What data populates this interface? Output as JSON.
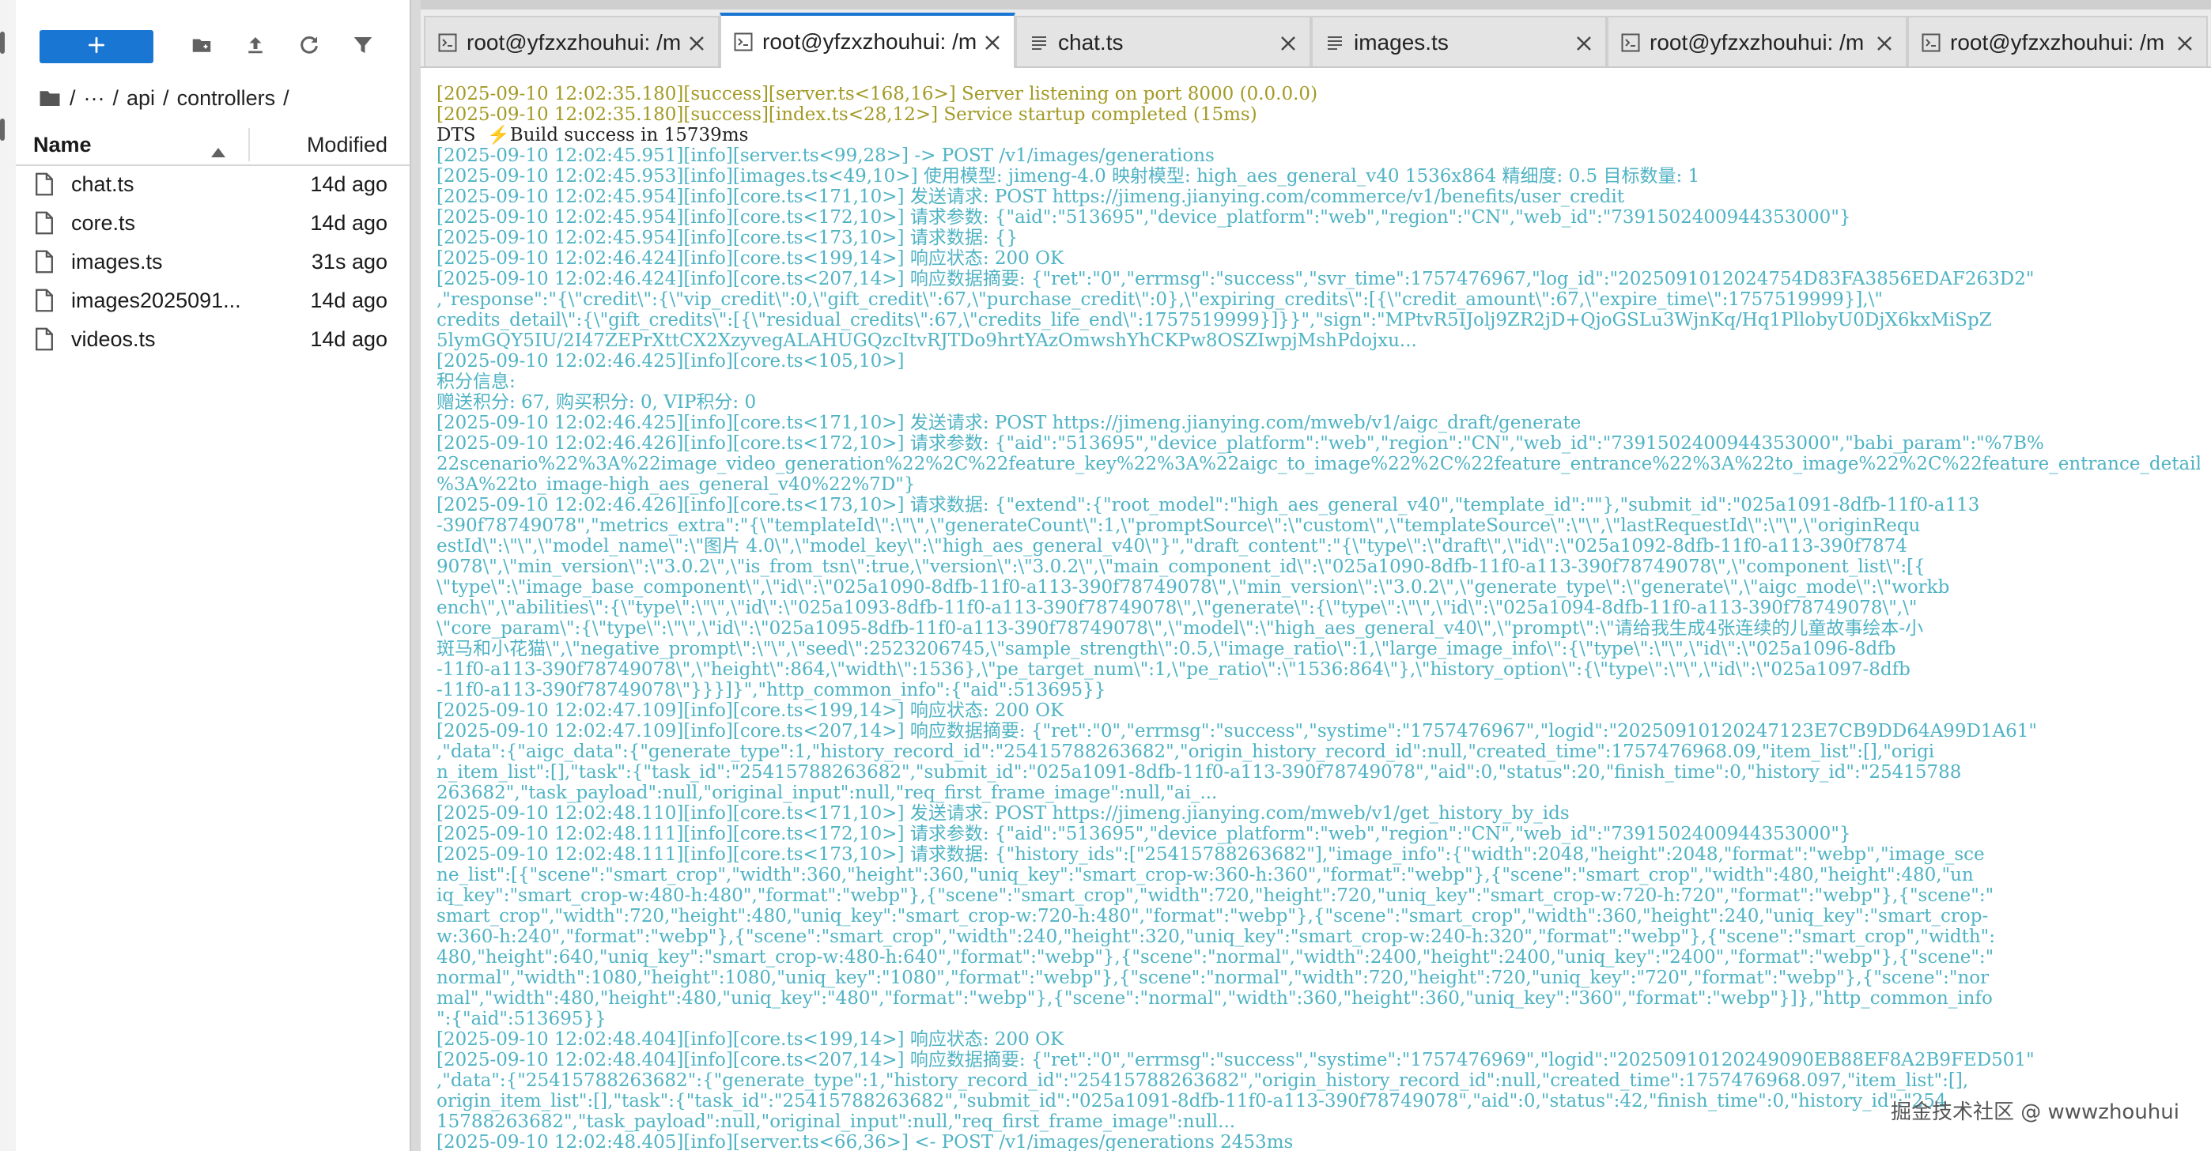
{
  "colors": {
    "accent": "#1976d2",
    "success_log": "#a39a25",
    "info_log": "#4fb3c4"
  },
  "file_browser": {
    "toolbar": {
      "new_icon": "plus-icon",
      "icons": [
        "new-folder-icon",
        "upload-icon",
        "refresh-icon",
        "filter-icon"
      ]
    },
    "breadcrumb": [
      "/",
      "···",
      "/",
      "api",
      "/",
      "controllers",
      "/"
    ],
    "columns": {
      "name": "Name",
      "modified": "Modified"
    },
    "files": [
      {
        "name": "chat.ts",
        "modified": "14d ago"
      },
      {
        "name": "core.ts",
        "modified": "14d ago"
      },
      {
        "name": "images.ts",
        "modified": "31s ago"
      },
      {
        "name": "images2025091...",
        "modified": "14d ago"
      },
      {
        "name": "videos.ts",
        "modified": "14d ago"
      }
    ]
  },
  "tabs": [
    {
      "label": "root@yfzxzhouhui: /m",
      "icon": "terminal-icon",
      "active": false
    },
    {
      "label": "root@yfzxzhouhui: /m",
      "icon": "terminal-icon",
      "active": true
    },
    {
      "label": "chat.ts",
      "icon": "text-file-icon",
      "active": false
    },
    {
      "label": "images.ts",
      "icon": "text-file-icon",
      "active": false
    },
    {
      "label": "root@yfzxzhouhui: /m",
      "icon": "terminal-icon",
      "active": false
    },
    {
      "label": "root@yfzxzhouhui: /m",
      "icon": "terminal-icon",
      "active": false
    }
  ],
  "terminal": {
    "lines": [
      {
        "kind": "ok",
        "text": "[2025-09-10 12:02:35.180][success][server.ts<168,16>] Server listening on port 8000 (0.0.0.0)"
      },
      {
        "kind": "ok",
        "text": "[2025-09-10 12:02:35.180][success][index.ts<28,12>] Service startup completed (15ms)"
      },
      {
        "kind": "plain",
        "text": "DTS  ⚡Build success in 15739ms"
      },
      {
        "kind": "info",
        "text": "[2025-09-10 12:02:45.951][info][server.ts<99,28>] -> POST /v1/images/generations"
      },
      {
        "kind": "info",
        "text": "[2025-09-10 12:02:45.953][info][images.ts<49,10>] 使用模型: jimeng-4.0 映射模型: high_aes_general_v40 1536x864 精细度: 0.5 目标数量: 1"
      },
      {
        "kind": "info",
        "text": "[2025-09-10 12:02:45.954][info][core.ts<171,10>] 发送请求: POST https://jimeng.jianying.com/commerce/v1/benefits/user_credit"
      },
      {
        "kind": "info",
        "text": "[2025-09-10 12:02:45.954][info][core.ts<172,10>] 请求参数: {\"aid\":\"513695\",\"device_platform\":\"web\",\"region\":\"CN\",\"web_id\":\"7391502400944353000\"}"
      },
      {
        "kind": "info",
        "text": "[2025-09-10 12:02:45.954][info][core.ts<173,10>] 请求数据: {}"
      },
      {
        "kind": "info",
        "text": "[2025-09-10 12:02:46.424][info][core.ts<199,14>] 响应状态: 200 OK"
      },
      {
        "kind": "info",
        "text": "[2025-09-10 12:02:46.424][info][core.ts<207,14>] 响应数据摘要: {\"ret\":\"0\",\"errmsg\":\"success\",\"svr_time\":1757476967,\"log_id\":\"2025091012024754D83FA3856EDAF263D2\""
      },
      {
        "kind": "info",
        "text": ",\"response\":\"{\\\"credit\\\":{\\\"vip_credit\\\":0,\\\"gift_credit\\\":67,\\\"purchase_credit\\\":0},\\\"expiring_credits\\\":[{\\\"credit_amount\\\":67,\\\"expire_time\\\":1757519999}],\\\""
      },
      {
        "kind": "info",
        "text": "credits_detail\\\":{\\\"gift_credits\\\":[{\\\"residual_credits\\\":67,\\\"credits_life_end\\\":1757519999}]}}\",\"sign\":\"MPtvR5IJolj9ZR2jD+QjoGSLu3WjnKq/Hq1PllobyU0DjX6kxMiSpZ"
      },
      {
        "kind": "info",
        "text": "5lymGQY5IU/2I47ZEPrXttCX2XzyvegALAHUGQzcItvRJTDo9hrtYAzOmwshYhCKPw8OSZIwpjMshPdojxu..."
      },
      {
        "kind": "info",
        "text": "[2025-09-10 12:02:46.425][info][core.ts<105,10>]"
      },
      {
        "kind": "info",
        "text": "积分信息:"
      },
      {
        "kind": "info",
        "text": "赠送积分: 67, 购买积分: 0, VIP积分: 0"
      },
      {
        "kind": "info",
        "text": "[2025-09-10 12:02:46.425][info][core.ts<171,10>] 发送请求: POST https://jimeng.jianying.com/mweb/v1/aigc_draft/generate"
      },
      {
        "kind": "info",
        "text": "[2025-09-10 12:02:46.426][info][core.ts<172,10>] 请求参数: {\"aid\":\"513695\",\"device_platform\":\"web\",\"region\":\"CN\",\"web_id\":\"7391502400944353000\",\"babi_param\":\"%7B%"
      },
      {
        "kind": "info",
        "text": "22scenario%22%3A%22image_video_generation%22%2C%22feature_key%22%3A%22aigc_to_image%22%2C%22feature_entrance%22%3A%22to_image%22%2C%22feature_entrance_detail%22"
      },
      {
        "kind": "info",
        "text": "%3A%22to_image-high_aes_general_v40%22%7D\"}"
      },
      {
        "kind": "info",
        "text": "[2025-09-10 12:02:46.426][info][core.ts<173,10>] 请求数据: {\"extend\":{\"root_model\":\"high_aes_general_v40\",\"template_id\":\"\"},\"submit_id\":\"025a1091-8dfb-11f0-a113"
      },
      {
        "kind": "info",
        "text": "-390f78749078\",\"metrics_extra\":\"{\\\"templateId\\\":\\\"\\\",\\\"generateCount\\\":1,\\\"promptSource\\\":\\\"custom\\\",\\\"templateSource\\\":\\\"\\\",\\\"lastRequestId\\\":\\\"\\\",\\\"originRequ"
      },
      {
        "kind": "info",
        "text": "estId\\\":\\\"\\\",\\\"model_name\\\":\\\"图片 4.0\\\",\\\"model_key\\\":\\\"high_aes_general_v40\\\"}\",\"draft_content\":\"{\\\"type\\\":\\\"draft\\\",\\\"id\\\":\\\"025a1092-8dfb-11f0-a113-390f7874"
      },
      {
        "kind": "info",
        "text": "9078\\\",\\\"min_version\\\":\\\"3.0.2\\\",\\\"is_from_tsn\\\":true,\\\"version\\\":\\\"3.0.2\\\",\\\"main_component_id\\\":\\\"025a1090-8dfb-11f0-a113-390f78749078\\\",\\\"component_list\\\":[{"
      },
      {
        "kind": "info",
        "text": "\\\"type\\\":\\\"image_base_component\\\",\\\"id\\\":\\\"025a1090-8dfb-11f0-a113-390f78749078\\\",\\\"min_version\\\":\\\"3.0.2\\\",\\\"generate_type\\\":\\\"generate\\\",\\\"aigc_mode\\\":\\\"workb"
      },
      {
        "kind": "info",
        "text": "ench\\\",\\\"abilities\\\":{\\\"type\\\":\\\"\\\",\\\"id\\\":\\\"025a1093-8dfb-11f0-a113-390f78749078\\\",\\\"generate\\\":{\\\"type\\\":\\\"\\\",\\\"id\\\":\\\"025a1094-8dfb-11f0-a113-390f78749078\\\",\\\""
      },
      {
        "kind": "info",
        "text": "\\\"core_param\\\":{\\\"type\\\":\\\"\\\",\\\"id\\\":\\\"025a1095-8dfb-11f0-a113-390f78749078\\\",\\\"model\\\":\\\"high_aes_general_v40\\\",\\\"prompt\\\":\\\"请给我生成4张连续的儿童故事绘本-小"
      },
      {
        "kind": "info",
        "text": "斑马和小花猫\\\",\\\"negative_prompt\\\":\\\"\\\",\\\"seed\\\":2523206745,\\\"sample_strength\\\":0.5,\\\"image_ratio\\\":1,\\\"large_image_info\\\":{\\\"type\\\":\\\"\\\",\\\"id\\\":\\\"025a1096-8dfb"
      },
      {
        "kind": "info",
        "text": "-11f0-a113-390f78749078\\\",\\\"height\\\":864,\\\"width\\\":1536},\\\"pe_target_num\\\":1,\\\"pe_ratio\\\":\\\"1536:864\\\"},\\\"history_option\\\":{\\\"type\\\":\\\"\\\",\\\"id\\\":\\\"025a1097-8dfb"
      },
      {
        "kind": "info",
        "text": "-11f0-a113-390f78749078\\\"}}}]}\",\"http_common_info\":{\"aid\":513695}}"
      },
      {
        "kind": "info",
        "text": "[2025-09-10 12:02:47.109][info][core.ts<199,14>] 响应状态: 200 OK"
      },
      {
        "kind": "info",
        "text": "[2025-09-10 12:02:47.109][info][core.ts<207,14>] 响应数据摘要: {\"ret\":\"0\",\"errmsg\":\"success\",\"systime\":\"1757476967\",\"logid\":\"20250910120247123E7CB9DD64A99D1A61\""
      },
      {
        "kind": "info",
        "text": ",\"data\":{\"aigc_data\":{\"generate_type\":1,\"history_record_id\":\"25415788263682\",\"origin_history_record_id\":null,\"created_time\":1757476968.09,\"item_list\":[],\"origi"
      },
      {
        "kind": "info",
        "text": "n_item_list\":[],\"task\":{\"task_id\":\"25415788263682\",\"submit_id\":\"025a1091-8dfb-11f0-a113-390f78749078\",\"aid\":0,\"status\":20,\"finish_time\":0,\"history_id\":\"25415788"
      },
      {
        "kind": "info",
        "text": "263682\",\"task_payload\":null,\"original_input\":null,\"req_first_frame_image\":null,\"ai_..."
      },
      {
        "kind": "info",
        "text": "[2025-09-10 12:02:48.110][info][core.ts<171,10>] 发送请求: POST https://jimeng.jianying.com/mweb/v1/get_history_by_ids"
      },
      {
        "kind": "info",
        "text": "[2025-09-10 12:02:48.111][info][core.ts<172,10>] 请求参数: {\"aid\":\"513695\",\"device_platform\":\"web\",\"region\":\"CN\",\"web_id\":\"7391502400944353000\"}"
      },
      {
        "kind": "info",
        "text": "[2025-09-10 12:02:48.111][info][core.ts<173,10>] 请求数据: {\"history_ids\":[\"25415788263682\"],\"image_info\":{\"width\":2048,\"height\":2048,\"format\":\"webp\",\"image_sce"
      },
      {
        "kind": "info",
        "text": "ne_list\":[{\"scene\":\"smart_crop\",\"width\":360,\"height\":360,\"uniq_key\":\"smart_crop-w:360-h:360\",\"format\":\"webp\"},{\"scene\":\"smart_crop\",\"width\":480,\"height\":480,\"un"
      },
      {
        "kind": "info",
        "text": "iq_key\":\"smart_crop-w:480-h:480\",\"format\":\"webp\"},{\"scene\":\"smart_crop\",\"width\":720,\"height\":720,\"uniq_key\":\"smart_crop-w:720-h:720\",\"format\":\"webp\"},{\"scene\":\""
      },
      {
        "kind": "info",
        "text": "smart_crop\",\"width\":720,\"height\":480,\"uniq_key\":\"smart_crop-w:720-h:480\",\"format\":\"webp\"},{\"scene\":\"smart_crop\",\"width\":360,\"height\":240,\"uniq_key\":\"smart_crop-"
      },
      {
        "kind": "info",
        "text": "w:360-h:240\",\"format\":\"webp\"},{\"scene\":\"smart_crop\",\"width\":240,\"height\":320,\"uniq_key\":\"smart_crop-w:240-h:320\",\"format\":\"webp\"},{\"scene\":\"smart_crop\",\"width\":"
      },
      {
        "kind": "info",
        "text": "480,\"height\":640,\"uniq_key\":\"smart_crop-w:480-h:640\",\"format\":\"webp\"},{\"scene\":\"normal\",\"width\":2400,\"height\":2400,\"uniq_key\":\"2400\",\"format\":\"webp\"},{\"scene\":\""
      },
      {
        "kind": "info",
        "text": "normal\",\"width\":1080,\"height\":1080,\"uniq_key\":\"1080\",\"format\":\"webp\"},{\"scene\":\"normal\",\"width\":720,\"height\":720,\"uniq_key\":\"720\",\"format\":\"webp\"},{\"scene\":\"nor"
      },
      {
        "kind": "info",
        "text": "mal\",\"width\":480,\"height\":480,\"uniq_key\":\"480\",\"format\":\"webp\"},{\"scene\":\"normal\",\"width\":360,\"height\":360,\"uniq_key\":\"360\",\"format\":\"webp\"}]},\"http_common_info"
      },
      {
        "kind": "info",
        "text": "\":{\"aid\":513695}}"
      },
      {
        "kind": "info",
        "text": "[2025-09-10 12:02:48.404][info][core.ts<199,14>] 响应状态: 200 OK"
      },
      {
        "kind": "info",
        "text": "[2025-09-10 12:02:48.404][info][core.ts<207,14>] 响应数据摘要: {\"ret\":\"0\",\"errmsg\":\"success\",\"systime\":\"1757476969\",\"logid\":\"20250910120249090EB88EF8A2B9FED501\""
      },
      {
        "kind": "info",
        "text": ",\"data\":{\"25415788263682\":{\"generate_type\":1,\"history_record_id\":\"25415788263682\",\"origin_history_record_id\":null,\"created_time\":1757476968.097,\"item_list\":[],"
      },
      {
        "kind": "info",
        "text": "origin_item_list\":[],\"task\":{\"task_id\":\"25415788263682\",\"submit_id\":\"025a1091-8dfb-11f0-a113-390f78749078\",\"aid\":0,\"status\":42,\"finish_time\":0,\"history_id\":\"254"
      },
      {
        "kind": "info",
        "text": "15788263682\",\"task_payload\":null,\"original_input\":null,\"req_first_frame_image\":null..."
      },
      {
        "kind": "info",
        "text": "[2025-09-10 12:02:48.405][info][server.ts<66,36>] <- POST /v1/images/generations 2453ms"
      }
    ]
  },
  "watermark": "掘金技术社区 @ wwwzhouhui"
}
